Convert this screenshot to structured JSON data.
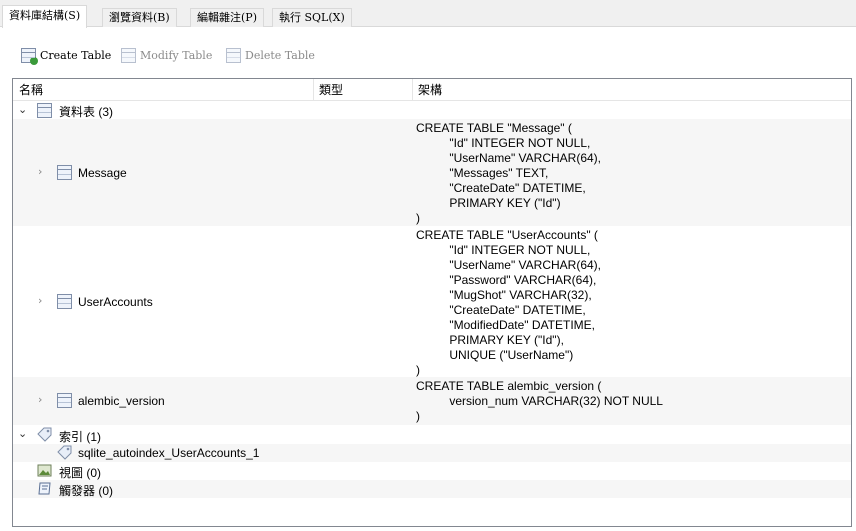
{
  "tabs": [
    {
      "label": "資料庫結構(S)",
      "active": true
    },
    {
      "label": "瀏覽資料(B)",
      "active": false
    },
    {
      "label": "編輯雜注(P)",
      "active": false
    },
    {
      "label": "執行 SQL(X)",
      "active": false
    }
  ],
  "toolbar": {
    "create_label": "Create Table",
    "modify_label": "Modify Table",
    "delete_label": "Delete Table"
  },
  "columns": {
    "name": "名稱",
    "type": "類型",
    "schema": "架構"
  },
  "tree": {
    "tables_group": "資料表 (3)",
    "tables": [
      {
        "name": "Message",
        "schema": "CREATE TABLE \"Message\" (\n\t\t\"Id\" INTEGER NOT NULL,\n\t\t\"UserName\" VARCHAR(64),\n\t\t\"Messages\" TEXT,\n\t\t\"CreateDate\" DATETIME,\n\t\tPRIMARY KEY (\"Id\")\n)"
      },
      {
        "name": "UserAccounts",
        "schema": "CREATE TABLE \"UserAccounts\" (\n\t\t\"Id\" INTEGER NOT NULL,\n\t\t\"UserName\" VARCHAR(64),\n\t\t\"Password\" VARCHAR(64),\n\t\t\"MugShot\" VARCHAR(32),\n\t\t\"CreateDate\" DATETIME,\n\t\t\"ModifiedDate\" DATETIME,\n\t\tPRIMARY KEY (\"Id\"),\n\t\tUNIQUE (\"UserName\")\n)"
      },
      {
        "name": "alembic_version",
        "schema": "CREATE TABLE alembic_version (\n\t\tversion_num VARCHAR(32) NOT NULL\n)"
      }
    ],
    "indexes_group": "索引 (1)",
    "index_item": "sqlite_autoindex_UserAccounts_1",
    "views_group": "視圖 (0)",
    "triggers_group": "觸發器 (0)"
  }
}
